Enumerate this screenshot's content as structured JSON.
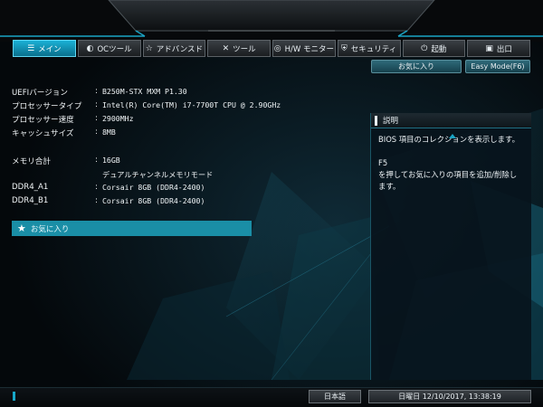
{
  "colors": {
    "accent": "#1aa4c4",
    "favorite_bar": "#1a8ea6",
    "background": "#05090d"
  },
  "menu": [
    {
      "label": "メイン",
      "icon": "list-icon",
      "glyph": "☰",
      "active": true
    },
    {
      "label": "OCツール",
      "icon": "dial-icon",
      "glyph": "◐",
      "active": false
    },
    {
      "label": "アドバンスド",
      "icon": "star-icon",
      "glyph": "☆",
      "active": false
    },
    {
      "label": "ツール",
      "icon": "tools-icon",
      "glyph": "✕",
      "active": false
    },
    {
      "label": "H/W モニター",
      "icon": "monitor-icon",
      "glyph": "◎",
      "active": false
    },
    {
      "label": "セキュリティ",
      "icon": "shield-icon",
      "glyph": "⛨",
      "active": false
    },
    {
      "label": "起動",
      "icon": "power-icon",
      "glyph": "⏻",
      "active": false
    },
    {
      "label": "出口",
      "icon": "exit-icon",
      "glyph": "▣",
      "active": false
    }
  ],
  "buttons": {
    "favorites": "お気に入り",
    "easy_mode": "Easy Mode(F6)"
  },
  "info": {
    "uefi_label": "UEFIバージョン",
    "uefi_value": "B250M-STX MXM P1.30",
    "cpu_type_label": "プロセッサータイプ",
    "cpu_type_value": "Intel(R) Core(TM) i7-7700T CPU @ 2.90GHz",
    "cpu_speed_label": "プロセッサー速度",
    "cpu_speed_value": "2900MHz",
    "cache_label": "キャッシュサイズ",
    "cache_value": "8MB",
    "memory_label": "メモリ合計",
    "memory_value": "16GB",
    "memory_mode": "デュアルチャンネルメモリモード",
    "dimm_a1_label": "DDR4_A1",
    "dimm_a1_value": "Corsair 8GB (DDR4-2400)",
    "dimm_b1_label": "DDR4_B1",
    "dimm_b1_value": "Corsair 8GB (DDR4-2400)",
    "separator": ":"
  },
  "favorites_row": {
    "label": "お気に入り",
    "icon": "star-icon"
  },
  "description": {
    "title": "説明",
    "body": "BIOS 項目のコレクションを表示します。\n\nF5\nを押してお気に入りの項目を追加/削除します。"
  },
  "status": {
    "language": "日本語",
    "datetime": "日曜日 12/10/2017, 13:38:19"
  }
}
